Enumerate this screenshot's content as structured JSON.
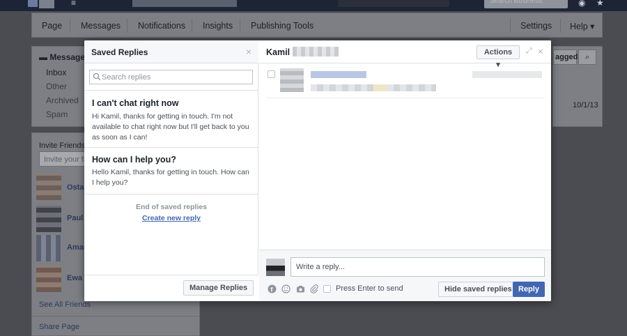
{
  "topbar": {
    "menu_glyph": "≡",
    "search_placeholder": "Search Business",
    "globe_glyph": "◉",
    "star_glyph": "★"
  },
  "page_nav": {
    "items": [
      "Page",
      "Messages",
      "Notifications",
      "Insights",
      "Publishing Tools"
    ],
    "settings": "Settings",
    "help": "Help ▾"
  },
  "left_sidebar": {
    "messages_header": "Messages",
    "folders": [
      "Inbox",
      "Other",
      "Archived",
      "Spam"
    ],
    "invite_title": "Invite Friends t",
    "invite_placeholder": "Invite your frie",
    "friends": [
      "Ostap",
      "Paul",
      "Amar",
      "Ewa"
    ],
    "see_all": "See All Friends",
    "share_page": "Share Page"
  },
  "right_sidebar": {
    "tagged_label": "agged",
    "date": "10/1/13"
  },
  "saved_replies": {
    "title": "Saved Replies",
    "close_glyph": "×",
    "search_placeholder": "Search replies",
    "replies": [
      {
        "title": "I can't chat right now",
        "body": "Hi Kamil, thanks for getting in touch. I'm not available to chat right now but I'll get back to you as soon as I can!"
      },
      {
        "title": "How can I help you?",
        "body": "Hello Kamil, thanks for getting in touch. How can I help you?"
      }
    ],
    "end_text": "End of saved replies",
    "create_link": "Create new reply",
    "manage_button": "Manage Replies"
  },
  "conversation": {
    "contact_name": "Kamil",
    "actions_button": "Actions ▾",
    "expand_glyph": "⤢",
    "close_glyph": "×",
    "compose_placeholder": "Write a reply...",
    "press_enter_label": "Press Enter to send",
    "hide_button": "Hide saved replies",
    "reply_button": "Reply",
    "icons": [
      "facebook-icon",
      "emoji-icon",
      "camera-icon",
      "paperclip-icon"
    ]
  },
  "colors": {
    "accent": "#4267b2",
    "overlay": "#4a4c52",
    "border": "#dddfe2"
  }
}
